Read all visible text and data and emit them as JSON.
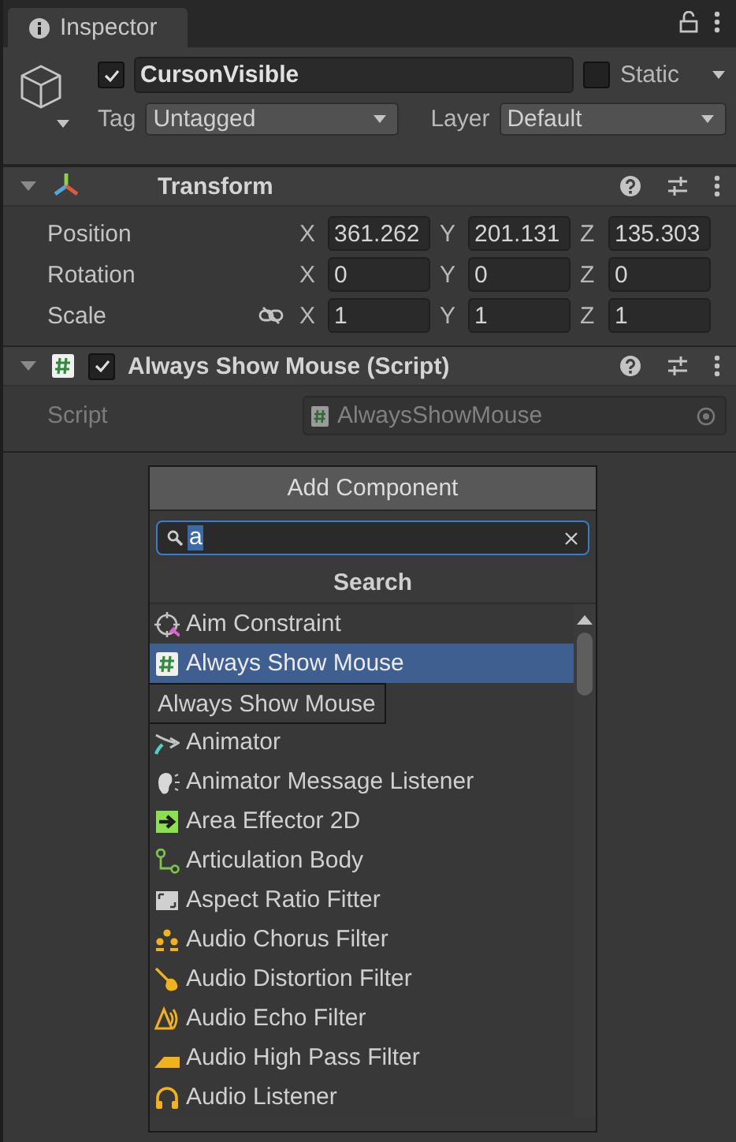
{
  "tab": {
    "title": "Inspector"
  },
  "object": {
    "active": true,
    "name": "CursonVisible",
    "static": false,
    "static_label": "Static",
    "tag_label": "Tag",
    "tag": "Untagged",
    "layer_label": "Layer",
    "layer": "Default"
  },
  "components": [
    {
      "kind": "transform",
      "title": "Transform",
      "expanded": true,
      "rows": [
        {
          "label": "Position",
          "values": [
            {
              "axis": "X",
              "value": "361.262"
            },
            {
              "axis": "Y",
              "value": "201.131"
            },
            {
              "axis": "Z",
              "value": "135.303"
            }
          ]
        },
        {
          "label": "Rotation",
          "values": [
            {
              "axis": "X",
              "value": "0"
            },
            {
              "axis": "Y",
              "value": "0"
            },
            {
              "axis": "Z",
              "value": "0"
            }
          ]
        },
        {
          "label": "Scale",
          "linked": false,
          "values": [
            {
              "axis": "X",
              "value": "1"
            },
            {
              "axis": "Y",
              "value": "1"
            },
            {
              "axis": "Z",
              "value": "1"
            }
          ]
        }
      ]
    },
    {
      "kind": "script",
      "title": "Always Show Mouse (Script)",
      "enabled": true,
      "expanded": true,
      "field_label": "Script",
      "field_value": "AlwaysShowMouse"
    }
  ],
  "popup": {
    "button": "Add Component",
    "search": {
      "value": "a"
    },
    "heading": "Search",
    "tooltip": "Always Show Mouse",
    "items": [
      {
        "label": "Aim Constraint",
        "kind": "constraint",
        "selected": false
      },
      {
        "label": "Always Show Mouse",
        "kind": "script",
        "selected": true
      },
      {
        "label": "Animator",
        "kind": "animator",
        "selected": false
      },
      {
        "label": "Animator Message Listener",
        "kind": "ear",
        "selected": false
      },
      {
        "label": "Area Effector 2D",
        "kind": "effector",
        "selected": false
      },
      {
        "label": "Articulation Body",
        "kind": "articulation",
        "selected": false
      },
      {
        "label": "Aspect Ratio Fitter",
        "kind": "fitter",
        "selected": false
      },
      {
        "label": "Audio Chorus Filter",
        "kind": "chorus",
        "selected": false
      },
      {
        "label": "Audio Distortion Filter",
        "kind": "distortion",
        "selected": false
      },
      {
        "label": "Audio Echo Filter",
        "kind": "echo",
        "selected": false
      },
      {
        "label": "Audio High Pass Filter",
        "kind": "highpass",
        "selected": false
      },
      {
        "label": "Audio Listener",
        "kind": "headphones",
        "selected": false
      }
    ]
  }
}
